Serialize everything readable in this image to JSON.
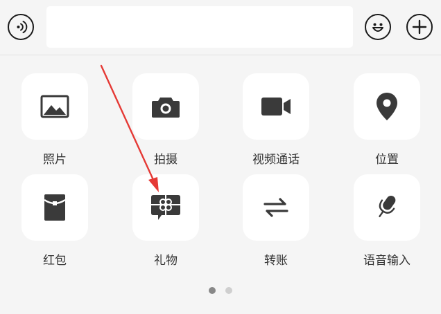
{
  "input_bar": {
    "voice_icon": "voice-input-icon",
    "emoji_icon": "emoji-icon",
    "plus_icon": "plus-icon",
    "text_value": "",
    "text_placeholder": ""
  },
  "panel": {
    "items": [
      {
        "label": "照片",
        "icon": "image-icon"
      },
      {
        "label": "拍摄",
        "icon": "camera-icon"
      },
      {
        "label": "视频通话",
        "icon": "video-call-icon"
      },
      {
        "label": "位置",
        "icon": "location-pin-icon"
      },
      {
        "label": "红包",
        "icon": "red-packet-icon"
      },
      {
        "label": "礼物",
        "icon": "gift-icon"
      },
      {
        "label": "转账",
        "icon": "transfer-icon"
      },
      {
        "label": "语音输入",
        "icon": "microphone-icon"
      }
    ],
    "pages": {
      "total": 2,
      "current": 1
    }
  },
  "annotation": {
    "color": "#e53935",
    "target": "gift-tile"
  },
  "colors": {
    "background": "#f5f5f5",
    "tile": "#ffffff",
    "icon": "#3a3a3a",
    "label": "#333333",
    "dot_active": "#888888",
    "dot_inactive": "#cfcfcf"
  }
}
